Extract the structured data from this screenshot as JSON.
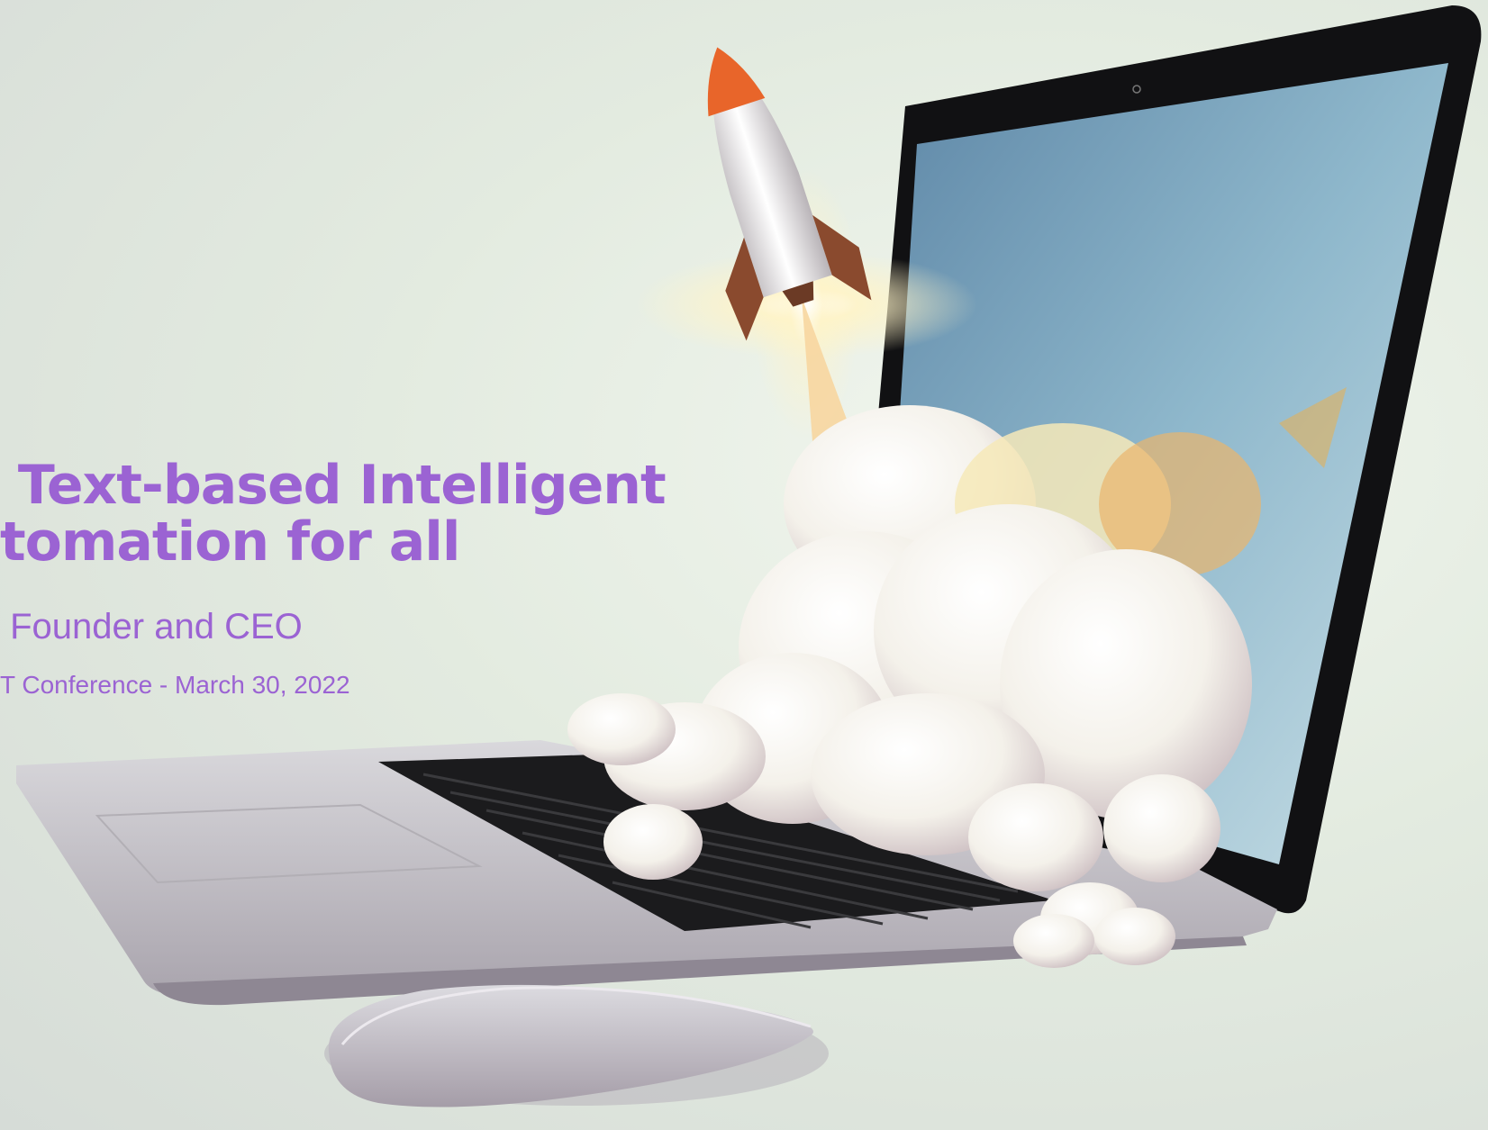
{
  "slide": {
    "title": " Text-based Intelligent\ntomation for all",
    "subtitle": " Founder and CEO",
    "event": "T Conference - March 30, 2022",
    "text_color": "#9b63d3"
  },
  "illustration": {
    "subject": "rocket launching from laptop screen with low-poly smoke clouds, mouse in foreground",
    "accent_colors": [
      "#e8652a",
      "#6e9ab8",
      "#1a1a1a",
      "#bdbbc0"
    ]
  }
}
